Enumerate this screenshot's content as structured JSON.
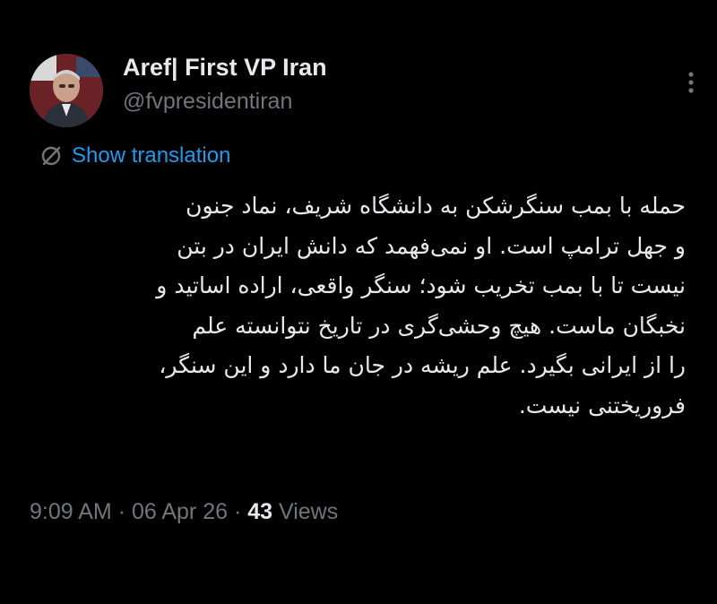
{
  "author": {
    "name": "Aref| First VP Iran",
    "handle": "@fvpresidentiran",
    "avatar_icon": "profile-photo"
  },
  "translation": {
    "label": "Show translation",
    "icon": "globe-slash-icon"
  },
  "tweet_lines": [
    "حمله با بمب سنگرشکن به دانشگاه شریف، نماد جنون",
    "و جهل ترامپ است. او نمی‌فهمد که دانش ایران در بتن",
    "نیست تا با بمب تخریب شود؛ سنگر واقعی، اراده اساتید و",
    "نخبگان ماست. هیچ وحشی‌گری  در تاریخ نتوانسته علم",
    "را از ایرانی بگیرد. علم ریشه در جان ما دارد و این سنگر،",
    "فروریختنی نیست."
  ],
  "meta": {
    "time": "9:09 AM",
    "separator": "·",
    "date": "06 Apr 26",
    "views_count": "43",
    "views_label": "Views"
  },
  "colors": {
    "background": "#000000",
    "primary_text": "#e7e9ea",
    "secondary_text": "#71767b",
    "link": "#1d9bf0"
  }
}
